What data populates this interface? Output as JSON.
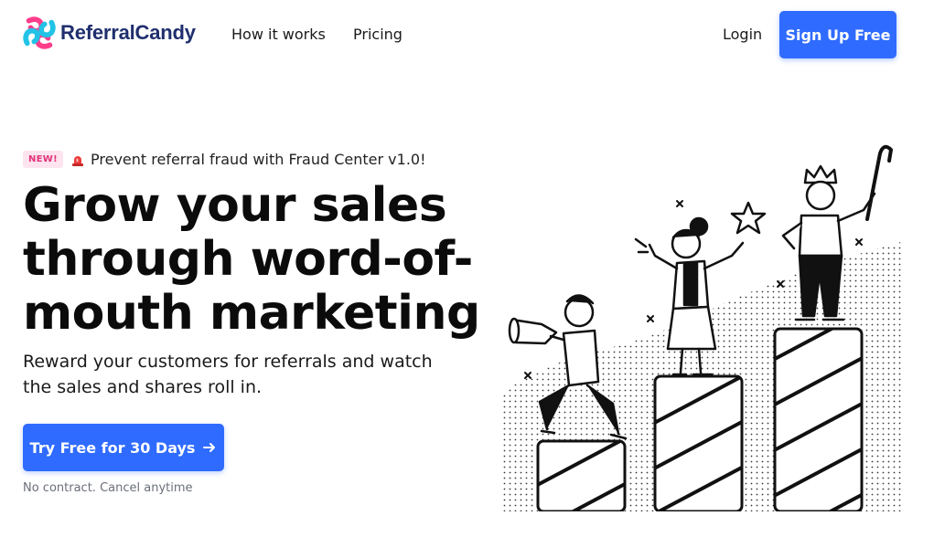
{
  "brand": {
    "name": "ReferralCandy",
    "logo_icon": "candy-swirl-logo",
    "colors": {
      "navy": "#1f2f6e",
      "pink": "#ff3d8b",
      "cyan": "#22c3e6"
    }
  },
  "nav": {
    "how_it_works": "How it works",
    "pricing": "Pricing",
    "login": "Login",
    "signup": "Sign Up Free"
  },
  "announcement": {
    "badge": "NEW!",
    "icon": "siren-icon",
    "text": "Prevent referral fraud with Fraud Center v1.0!"
  },
  "hero": {
    "headline": "Grow your sales through word-of-mouth marketing",
    "subtext": "Reward your customers for referrals and watch the sales and shares roll in.",
    "cta_label": "Try Free for 30 Days",
    "cta_icon": "arrow-right-icon",
    "fineprint": "No contract. Cancel anytime"
  },
  "theme": {
    "accent": "#2f6bff",
    "badge_bg": "#fde4ef",
    "badge_text": "#e3337a"
  }
}
